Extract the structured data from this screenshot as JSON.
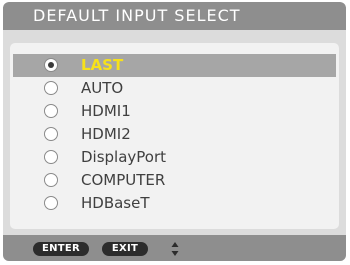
{
  "menu": {
    "title": "DEFAULT INPUT SELECT",
    "options": [
      {
        "label": "LAST",
        "selected": true
      },
      {
        "label": "AUTO",
        "selected": false
      },
      {
        "label": "HDMI1",
        "selected": false
      },
      {
        "label": "HDMI2",
        "selected": false
      },
      {
        "label": "DisplayPort",
        "selected": false
      },
      {
        "label": "COMPUTER",
        "selected": false
      },
      {
        "label": "HDBaseT",
        "selected": false
      }
    ]
  },
  "footer": {
    "enter_label": "ENTER",
    "exit_label": "EXIT",
    "nav_icon": "up-down-arrows-icon"
  },
  "colors": {
    "title_bar": "#8e8e8e",
    "window_bg": "#dcdcdc",
    "panel_bg": "#f2f2f2",
    "selected_row": "#a6a6a6",
    "selected_text": "#f7e11a",
    "normal_text": "#404040",
    "key_pill": "#2c2c2c"
  }
}
